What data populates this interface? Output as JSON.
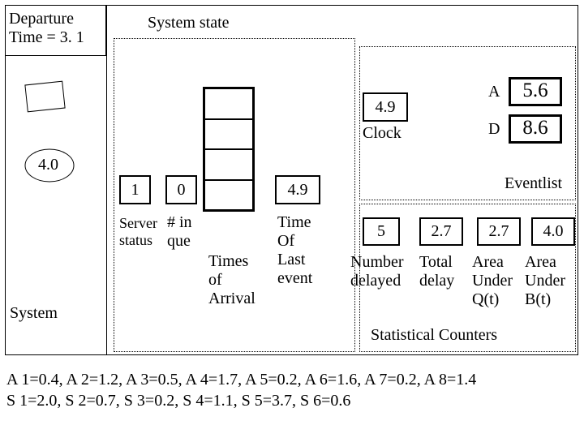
{
  "departure": "Departure\nTime = 3. 1",
  "system_state_label": "System state",
  "circle_value": "4.0",
  "system_label": "System",
  "server_status": {
    "value": "1",
    "label": "Server\nstatus"
  },
  "in_que": {
    "value": "0",
    "label": "# in\nque"
  },
  "times_of_arrival_label": "Times\nof\nArrival",
  "time_of_last_event": {
    "value": "4.9",
    "label": "Time\nOf\nLast\nevent"
  },
  "clock": {
    "value": "4.9",
    "label": "Clock"
  },
  "eventlist_label": "Eventlist",
  "A": {
    "label": "A",
    "value": "5.6"
  },
  "D": {
    "label": "D",
    "value": "8.6"
  },
  "stats": {
    "number_delayed": {
      "value": "5",
      "label": "Number\ndelayed"
    },
    "total_delay": {
      "value": "2.7",
      "label": "Total\ndelay"
    },
    "area_q": {
      "value": "2.7",
      "label": "Area\nUnder\nQ(t)"
    },
    "area_b": {
      "value": "4.0",
      "label": "Area\nUnder\nB(t)"
    }
  },
  "statistical_counters_label": "Statistical Counters",
  "footer_line1": "A 1=0.4, A 2=1.2, A 3=0.5, A 4=1.7, A 5=0.2, A 6=1.6, A 7=0.2, A 8=1.4",
  "footer_line2": "S 1=2.0, S 2=0.7, S 3=0.2, S 4=1.1, S 5=3.7, S 6=0.6"
}
